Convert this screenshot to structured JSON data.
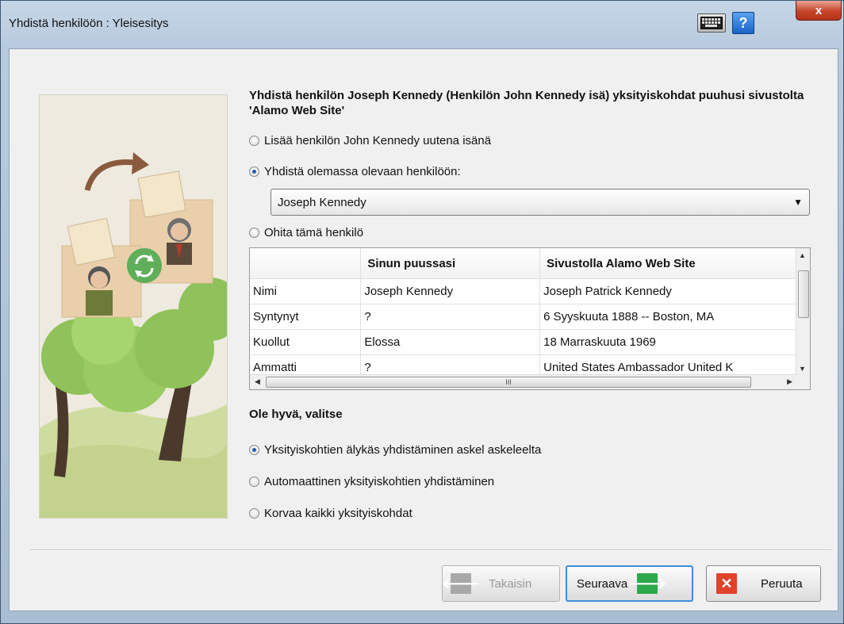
{
  "window": {
    "title": "Yhdistä henkilöön : Yleisesitys",
    "close_label": "x",
    "help_label": "?"
  },
  "icons": {
    "keyboard": "keyboard-icon",
    "help": "help-icon",
    "close": "close-icon",
    "back": "arrow-left-icon",
    "next": "arrow-right-icon",
    "cancel": "x-icon",
    "sync": "sync-icon"
  },
  "colors": {
    "next_icon": "#2ea84a",
    "cancel_icon": "#e0422a",
    "back_icon": "#a8a8a8",
    "sync_icon": "#5fae5a",
    "focus_border": "#3c8fd6"
  },
  "heading": "Yhdistä henkilön Joseph Kennedy (Henkilön John Kennedy isä) yksityiskohdat puuhusi sivustolta 'Alamo Web Site'",
  "merge_options": [
    {
      "label": "Lisää henkilön John Kennedy uutena isänä",
      "checked": false
    },
    {
      "label": "Yhdistä olemassa olevaan henkilöön:",
      "checked": true
    },
    {
      "label": "Ohita tämä henkilö",
      "checked": false
    }
  ],
  "person_select": {
    "value": "Joseph Kennedy"
  },
  "table": {
    "headers": [
      "",
      "Sinun puussasi",
      "Sivustolla Alamo Web Site"
    ],
    "rows": [
      [
        "Nimi",
        "Joseph Kennedy",
        "Joseph Patrick Kennedy"
      ],
      [
        "Syntynyt",
        "?",
        "6 Syyskuuta 1888 -- Boston, MA"
      ],
      [
        "Kuollut",
        "Elossa",
        "18 Marraskuuta 1969"
      ],
      [
        "Ammatti",
        "?",
        "United States Ambassador United K"
      ]
    ],
    "hscroll_grip": "III"
  },
  "choose_label": "Ole hyvä, valitse",
  "mode_options": [
    {
      "label": "Yksityiskohtien älykäs yhdistäminen askel askeleelta",
      "checked": true
    },
    {
      "label": "Automaattinen yksityiskohtien yhdistäminen",
      "checked": false
    },
    {
      "label": "Korvaa kaikki yksityiskohdat",
      "checked": false
    }
  ],
  "buttons": {
    "back": "Takaisin",
    "next": "Seuraava",
    "cancel": "Peruuta"
  }
}
